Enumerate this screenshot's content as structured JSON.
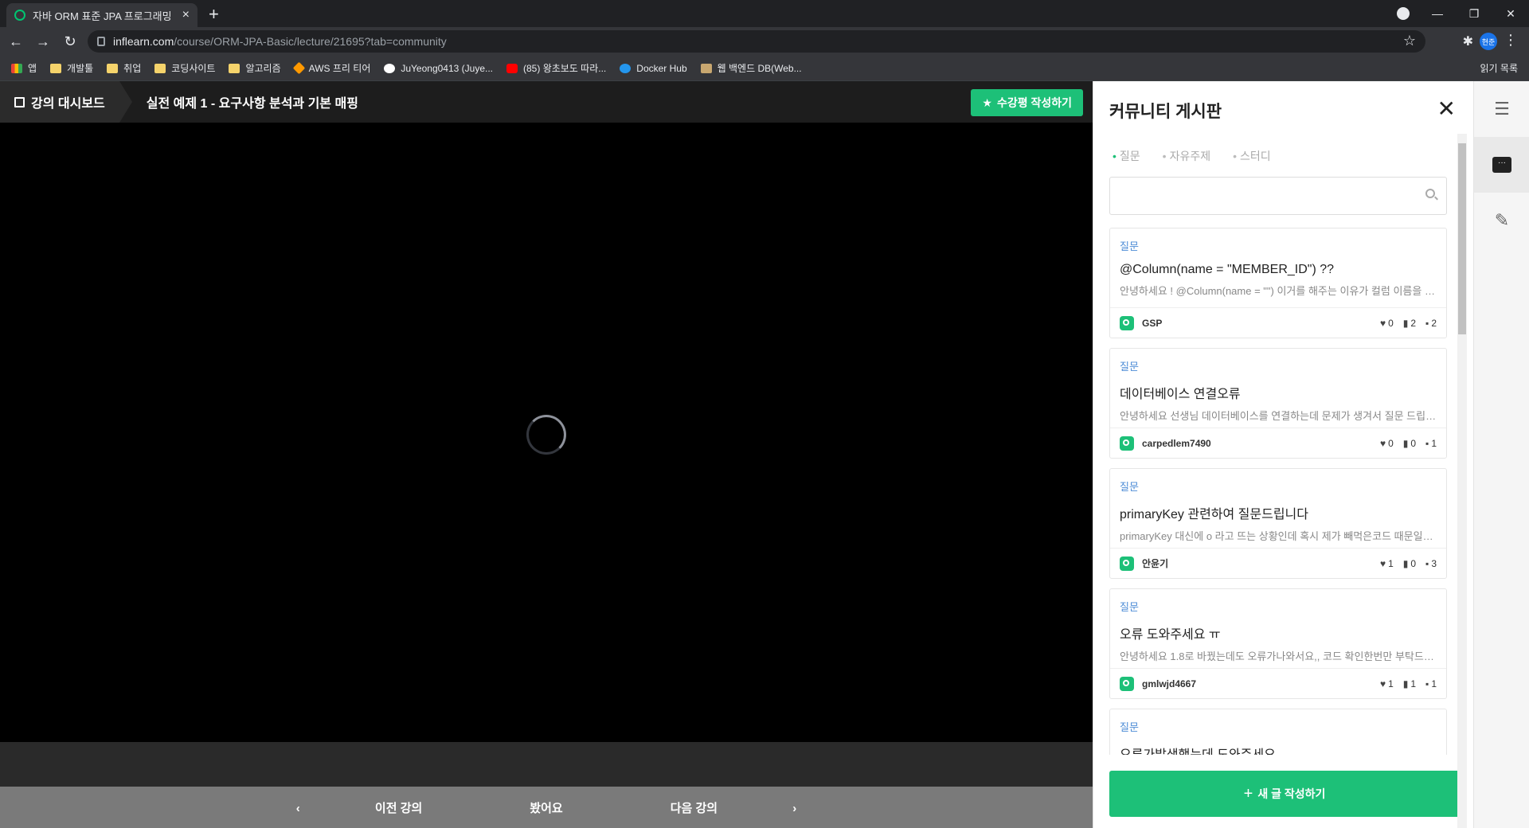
{
  "browser": {
    "tab_title": "자바 ORM 표준 JPA 프로그래밍",
    "tab_close": "×",
    "new_tab": "+",
    "url_host": "inflearn.com",
    "url_path": "/course/ORM-JPA-Basic/lecture/21695?tab=community",
    "profile_initials": "현준",
    "bookmarks": [
      "앱",
      "개발툴",
      "취업",
      "코딩사이트",
      "알고리즘",
      "AWS 프리 티어",
      "JuYeong0413 (Juye...",
      "(85) 왕초보도 따라...",
      "Docker Hub",
      "웹 백엔드 DB(Web..."
    ],
    "reading_list": "읽기 목록"
  },
  "lecture": {
    "dashboard_label": "강의 대시보드",
    "title": "실전 예제 1 - 요구사항 분석과 기본 매핑",
    "review_button": "수강평 작성하기",
    "prev_label": "이전 강의",
    "watched_label": "봤어요",
    "next_label": "다음 강의"
  },
  "community": {
    "title": "커뮤니티 게시판",
    "tabs": [
      {
        "label": "질문",
        "active": true
      },
      {
        "label": "자유주제",
        "active": false
      },
      {
        "label": "스터디",
        "active": false
      }
    ],
    "search_placeholder": "",
    "posts": [
      {
        "type": "질문",
        "title": "@Column(name = \"MEMBER_ID\") ??",
        "preview": "안녕하세요 ! @Column(name = \"\") 이거를 해주는 이유가 컬럼 이름을 매핑하기 위해서",
        "author": "GSP",
        "likes": "0",
        "bookmarks": "2",
        "comments": "2"
      },
      {
        "type": "질문",
        "title": "데이터베이스 연결오류",
        "preview": "안녕하세요 선생님 데이터베이스를 연결하는데 문제가 생겨서 질문 드립니다",
        "author": "carpedlem7490",
        "likes": "0",
        "bookmarks": "0",
        "comments": "1"
      },
      {
        "type": "질문",
        "title": "primaryKey 관련하여 질문드립니다",
        "preview": "primaryKey 대신에 o 라고 뜨는 상황인데 혹시 제가 빼먹은코드 때문일까요",
        "author": "안윤기",
        "likes": "1",
        "bookmarks": "0",
        "comments": "3"
      },
      {
        "type": "질문",
        "title": "오류 도와주세요 ㅠ",
        "preview": "안녕하세요 1.8로 바꿨는데도 오류가나와서요,, 코드 확인한번만 부탁드립니다",
        "author": "gmlwjd4667",
        "likes": "1",
        "bookmarks": "1",
        "comments": "1"
      },
      {
        "type": "질문",
        "title": "오류가발생했는데 도와주세요",
        "preview": "",
        "author": "",
        "likes": "",
        "bookmarks": "",
        "comments": ""
      }
    ],
    "new_post_button": "새 글 작성하기"
  },
  "icons": {
    "like": "heart-icon",
    "bookmark": "bookmark-icon",
    "comment": "comment-icon"
  },
  "colors": {
    "accent": "#1dc078",
    "post_type": "#4b8bd6"
  }
}
